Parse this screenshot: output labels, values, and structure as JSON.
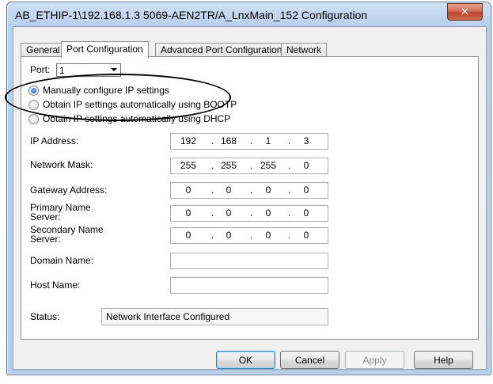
{
  "window": {
    "title": "AB_ETHIP-1\\192.168.1.3 5069-AEN2TR/A_LnxMain_152 Configuration",
    "close_label": "✕"
  },
  "tabs": [
    {
      "label": "General",
      "active": false
    },
    {
      "label": "Port Configuration",
      "active": true
    },
    {
      "label": "Advanced Port Configuration",
      "active": false
    },
    {
      "label": "Network",
      "active": false
    }
  ],
  "port": {
    "label": "Port:",
    "value": "1"
  },
  "ip_mode": {
    "options": [
      {
        "label": "Manually configure IP settings",
        "checked": true
      },
      {
        "label": "Obtain IP settings automatically using BOOTP",
        "checked": false
      },
      {
        "label": "Obtain IP settings automatically using DHCP",
        "checked": false
      }
    ]
  },
  "fields": {
    "ip_address": {
      "label": "IP Address:",
      "octets": [
        "192",
        "168",
        "1",
        "3"
      ]
    },
    "network_mask": {
      "label": "Network Mask:",
      "octets": [
        "255",
        "255",
        "255",
        "0"
      ]
    },
    "gateway": {
      "label": "Gateway Address:",
      "octets": [
        "0",
        "0",
        "0",
        "0"
      ]
    },
    "primary_dns": {
      "label_line1": "Primary Name",
      "label_line2": "Server:",
      "octets": [
        "0",
        "0",
        "0",
        "0"
      ]
    },
    "secondary_dns": {
      "label_line1": "Secondary Name",
      "label_line2": "Server:",
      "octets": [
        "0",
        "0",
        "0",
        "0"
      ]
    },
    "domain_name": {
      "label": "Domain Name:",
      "value": ""
    },
    "host_name": {
      "label": "Host Name:",
      "value": ""
    }
  },
  "status": {
    "label": "Status:",
    "value": "Network Interface Configured"
  },
  "buttons": {
    "ok": "OK",
    "cancel": "Cancel",
    "apply": "Apply",
    "help": "Help"
  },
  "dot_separator": "."
}
